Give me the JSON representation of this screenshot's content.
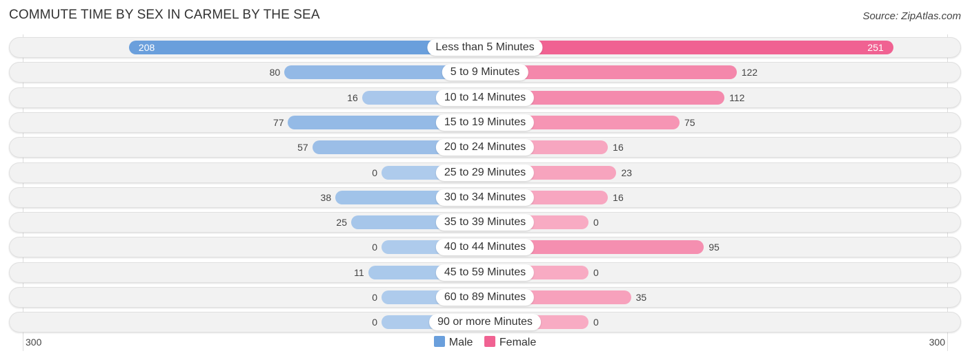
{
  "chart_data": {
    "type": "bar",
    "orientation": "horizontal-diverging",
    "title": "COMMUTE TIME BY SEX IN CARMEL BY THE SEA",
    "source": "Source: ZipAtlas.com",
    "categories": [
      "Less than 5 Minutes",
      "5 to 9 Minutes",
      "10 to 14 Minutes",
      "15 to 19 Minutes",
      "20 to 24 Minutes",
      "25 to 29 Minutes",
      "30 to 34 Minutes",
      "35 to 39 Minutes",
      "40 to 44 Minutes",
      "45 to 59 Minutes",
      "60 to 89 Minutes",
      "90 or more Minutes"
    ],
    "series": [
      {
        "name": "Male",
        "color": "#6a9fdc",
        "values": [
          208,
          80,
          16,
          77,
          57,
          0,
          38,
          25,
          0,
          11,
          0,
          0
        ]
      },
      {
        "name": "Female",
        "color": "#f06292",
        "values": [
          251,
          122,
          112,
          75,
          16,
          23,
          16,
          0,
          95,
          0,
          35,
          0
        ]
      }
    ],
    "axis": {
      "left_tick": "300",
      "right_tick": "300",
      "range": [
        -300,
        300
      ]
    },
    "legend": {
      "position": "bottom-center",
      "items": [
        "Male",
        "Female"
      ]
    }
  }
}
